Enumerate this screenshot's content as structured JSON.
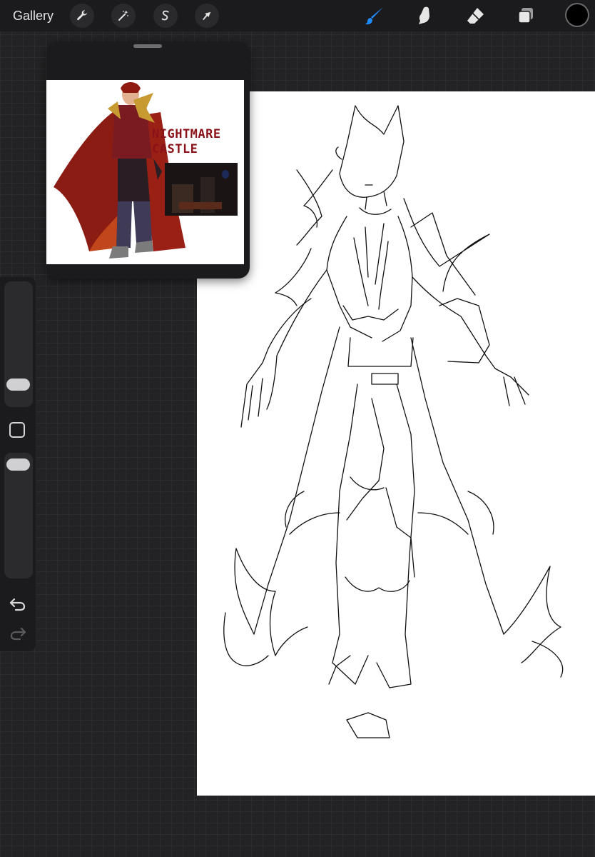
{
  "app": {
    "gallery_label": "Gallery"
  },
  "toolbar": {
    "left_tools": [
      {
        "name": "actions",
        "icon": "wrench-icon"
      },
      {
        "name": "adjustments",
        "icon": "magic-wand-icon"
      },
      {
        "name": "selection",
        "icon": "selection-s-icon"
      },
      {
        "name": "transform",
        "icon": "arrow-cursor-icon"
      }
    ],
    "right_tools": [
      {
        "name": "brush",
        "icon": "brush-icon",
        "active": true
      },
      {
        "name": "smudge",
        "icon": "smudge-finger-icon",
        "active": false
      },
      {
        "name": "eraser",
        "icon": "eraser-icon",
        "active": false
      },
      {
        "name": "layers",
        "icon": "layers-icon",
        "active": false
      }
    ],
    "active_color": "#000000",
    "accent_color": "#1e8bff"
  },
  "reference": {
    "title_line1": "NIGHTMARE",
    "title_line2": "CASTLE",
    "title_color": "#8a1218"
  },
  "sidebar": {
    "brush_size_level": 0.2,
    "opacity_level": 0.95,
    "icons": [
      "modifier-square-icon",
      "undo-icon",
      "redo-icon"
    ]
  }
}
